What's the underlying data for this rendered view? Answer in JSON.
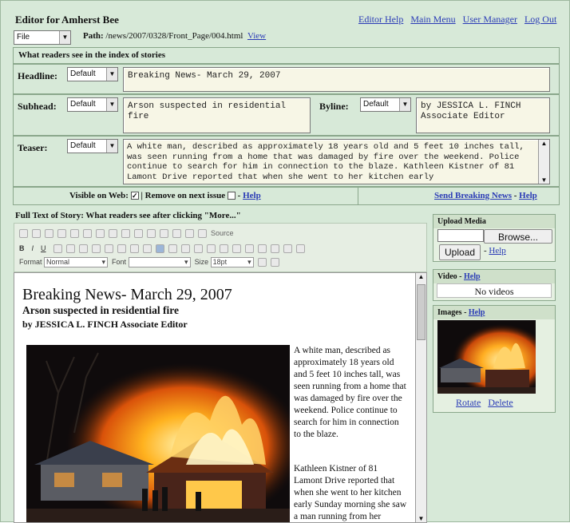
{
  "app_title": "Editor for Amherst Bee",
  "top_links": {
    "help": "Editor Help",
    "main": "Main Menu",
    "users": "User Manager",
    "logout": "Log Out"
  },
  "file_menu": "File",
  "path": {
    "label": "Path:",
    "value": "/news/2007/0328/Front_Page/004.html",
    "view": "View"
  },
  "index_caption": "What readers see in the index of stories",
  "headline": {
    "label": "Headline:",
    "style": "Default",
    "value": "Breaking News- March 29, 2007"
  },
  "subhead": {
    "label": "Subhead:",
    "style": "Default",
    "value": "Arson suspected in residential fire"
  },
  "byline": {
    "label": "Byline:",
    "style": "Default",
    "value": "by JESSICA L. FINCH Associate Editor"
  },
  "teaser": {
    "label": "Teaser:",
    "style": "Default",
    "value": " A white man, described as approximately 18 years old and 5 feet 10 inches tall, was seen running from a home that was damaged by fire over the weekend. Police continue to search for him in connection to the blaze.  Kathleen Kistner of 81 Lamont Drive reported that when she went to her kitchen early"
  },
  "visible_row": {
    "visible_label": "Visible on Web:",
    "remove_label": "| Remove on next issue",
    "help": "Help",
    "breaking": "Send Breaking News",
    "help2": "Help"
  },
  "fulltext_caption": "Full Text of Story: What readers see after clicking \"More...\"",
  "toolbar": {
    "source": "Source",
    "format_label": "Format",
    "format_value": "Normal",
    "font_label": "Font",
    "size_label": "Size",
    "size_value": "18pt"
  },
  "story": {
    "headline": "Breaking News- March 29, 2007",
    "subhead": "Arson suspected in residential fire",
    "byline": "by JESSICA L. FINCH Associate Editor",
    "para1": "A white man, described as approximately 18 years old and 5 feet 10 inches tall, was seen running from a home that was damaged by fire over the weekend. Police continue to search for him in connection to the blaze.",
    "para2": "Kathleen Kistner of 81 Lamont Drive reported that when she went to her kitchen early Sunday morning she saw a man running from her"
  },
  "upload": {
    "title": "Upload Media",
    "browse": "Browse...",
    "upload": "Upload",
    "help": "Help"
  },
  "video": {
    "title": "Video",
    "help": "Help",
    "empty": "No videos"
  },
  "images": {
    "title": "Images",
    "help": "Help",
    "rotate": "Rotate",
    "delete": "Delete"
  }
}
